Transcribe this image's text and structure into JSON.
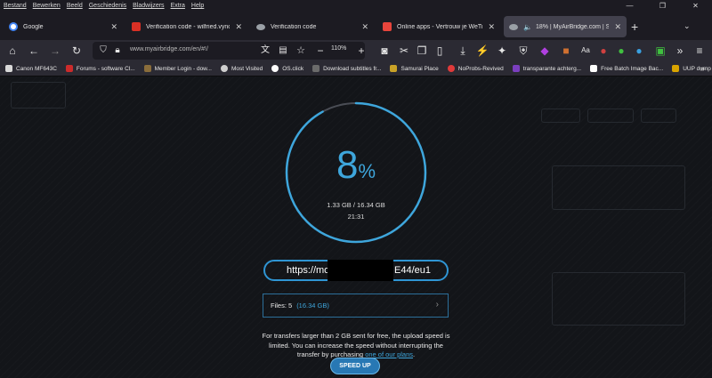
{
  "menu": [
    "Bestand",
    "Bewerken",
    "Beeld",
    "Geschiedenis",
    "Bladwijzers",
    "Extra",
    "Help"
  ],
  "window_controls": [
    "—",
    "❐",
    "✕"
  ],
  "tabs": [
    {
      "label": "Google",
      "favicon_color": "#4285f4"
    },
    {
      "label": "Verification code - wilfried.vynck@...",
      "favicon_color": "#d93025"
    },
    {
      "label": "Verification code",
      "favicon_color": "#9aa0a6"
    },
    {
      "label": "Online apps - Vertrouw je WeTransfer...",
      "favicon_color": "#e8453c"
    },
    {
      "label": "18% | MyAirBridge.com | Send or...",
      "favicon_color": "#9aa0a6",
      "active": true
    }
  ],
  "new_tab": "+",
  "tab_list": "⌄",
  "url": "www.myairbridge.com/en/#!/",
  "zoom": "110%",
  "bookmarks": [
    {
      "label": "Canon MF643C",
      "color": "#d9d9d9"
    },
    {
      "label": "Forums - software Cl...",
      "color": "#cc2b2b"
    },
    {
      "label": "Member Login - dow...",
      "color": "#8a6d3b"
    },
    {
      "label": "Most Visited",
      "color": "#cfcfcf"
    },
    {
      "label": "OS.click",
      "color": "#ffffff"
    },
    {
      "label": "Download subtitles fr...",
      "color": "#6b6b6b"
    },
    {
      "label": "Samurai Place",
      "color": "#c9a227"
    },
    {
      "label": "NoProbs-Revived",
      "color": "#e03a3a"
    },
    {
      "label": "transparante achterg...",
      "color": "#7b3fbf"
    },
    {
      "label": "Free Batch Image Bac...",
      "color": "#ffffff"
    },
    {
      "label": "UUP dump",
      "color": "#d9a400"
    }
  ],
  "upload": {
    "percent": "8",
    "percent_sign": "%",
    "progress_fraction": 0.08,
    "transferred": "1.33 GB / 16.34 GB",
    "time_remaining": "21:31",
    "link_prefix": "https://mo",
    "link_suffix": "E44/eu1",
    "files_label": "Files:",
    "files_count": "5",
    "files_size": "(16.34 GB)",
    "note_text": "For transfers larger than 2 GB sent for free, the upload speed is limited. You can increase the speed without interrupting the transfer by purchasing",
    "note_link": "one of our plans",
    "note_end": ".",
    "speed_button": "SPEED UP"
  },
  "accent_color": "#3ea6dc"
}
